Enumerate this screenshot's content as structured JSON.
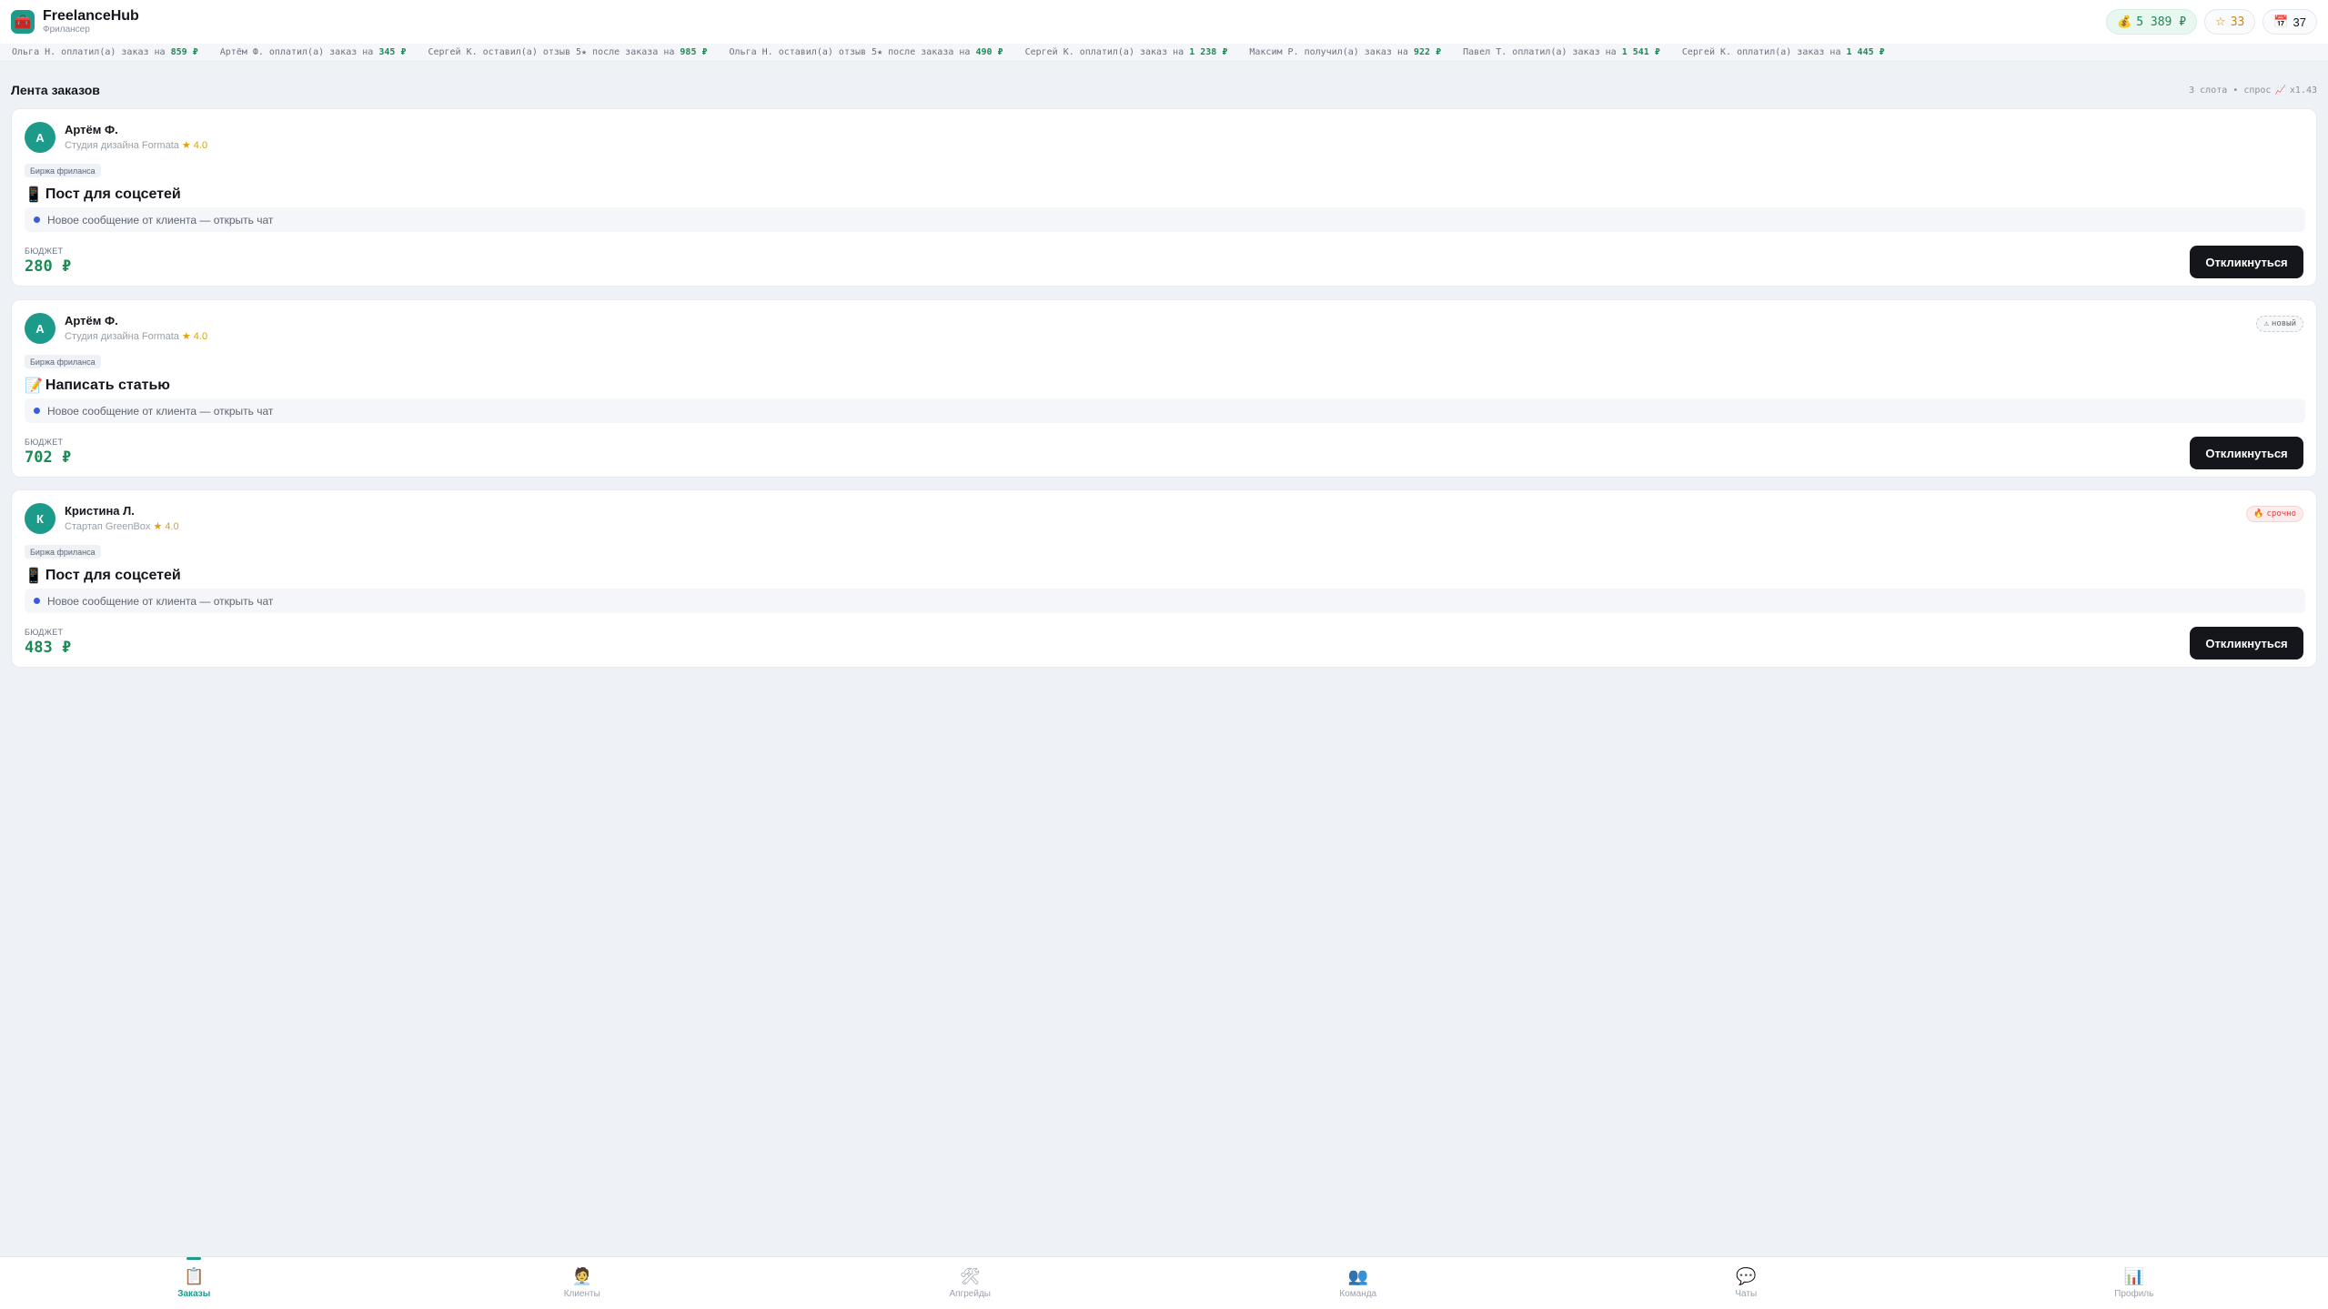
{
  "header": {
    "logo_icon": "🧰",
    "title": "FreelanceHub",
    "subtitle": "Фрилансер",
    "balance": "5 389 ₽",
    "balance_icon": "💰",
    "stars": "33",
    "stars_icon": "☆",
    "tasks": "37",
    "tasks_icon": "📅"
  },
  "ticker": [
    {
      "text": "Ольга Н. оплатил(а) заказ на",
      "amount": "859 ₽"
    },
    {
      "text": "Артём Ф. оплатил(а) заказ на",
      "amount": "345 ₽"
    },
    {
      "text": "Сергей К. оставил(а) отзыв 5★ после заказа на",
      "amount": "985 ₽"
    },
    {
      "text": "Ольга Н. оставил(а) отзыв 5★ после заказа на",
      "amount": "490 ₽"
    },
    {
      "text": "Сергей К. оплатил(а) заказ на",
      "amount": "1 238 ₽"
    },
    {
      "text": "Максим Р. получил(а) заказ на",
      "amount": "922 ₽"
    },
    {
      "text": "Павел Т. оплатил(а) заказ на",
      "amount": "1 541 ₽"
    },
    {
      "text": "Сергей К. оплатил(а) заказ на",
      "amount": "1 445 ₽"
    }
  ],
  "feed": {
    "title": "Лента заказов",
    "meta": "3 слота • спрос",
    "meta_icon": "📈",
    "multiplier": "x1.43"
  },
  "orders": [
    {
      "avatar_letter": "А",
      "client_name": "Артём Ф.",
      "company": "Студия дизайна Formata",
      "rating": "★ 4.0",
      "tag": "Биржа фриланса",
      "title_icon": "📱",
      "title": "Пост для соцсетей",
      "message": "Новое сообщение от клиента — открыть чат",
      "budget_label": "БЮДЖЕТ",
      "budget": "280 ₽",
      "button": "Откликнуться",
      "badge": "",
      "badge_icon": ""
    },
    {
      "avatar_letter": "А",
      "client_name": "Артём Ф.",
      "company": "Студия дизайна Formata",
      "rating": "★ 4.0",
      "tag": "Биржа фриланса",
      "title_icon": "📝",
      "title": "Написать статью",
      "message": "Новое сообщение от клиента — открыть чат",
      "budget_label": "БЮДЖЕТ",
      "budget": "702 ₽",
      "button": "Откликнуться",
      "badge": "новый",
      "badge_icon": "⚠"
    },
    {
      "avatar_letter": "К",
      "client_name": "Кристина Л.",
      "company": "Стартап GreenBox",
      "rating": "★ 4.0",
      "tag": "Биржа фриланса",
      "title_icon": "📱",
      "title": "Пост для соцсетей",
      "message": "Новое сообщение от клиента — открыть чат",
      "budget_label": "БЮДЖЕТ",
      "budget": "483 ₽",
      "button": "Откликнуться",
      "badge": "срочно",
      "badge_icon": "🔥"
    }
  ],
  "nav": [
    {
      "icon": "📋",
      "label": "Заказы",
      "active": true
    },
    {
      "icon": "🧑‍💼",
      "label": "Клиенты",
      "active": false
    },
    {
      "icon": "🛠",
      "label": "Апгрейды",
      "active": false
    },
    {
      "icon": "👥",
      "label": "Команда",
      "active": false
    },
    {
      "icon": "💬",
      "label": "Чаты",
      "active": false
    },
    {
      "icon": "📊",
      "label": "Профиль",
      "active": false
    }
  ],
  "colors": {
    "accent": "#1c9a8a",
    "money": "#1d8a55",
    "button": "#14161c",
    "background": "#eef1f6"
  }
}
